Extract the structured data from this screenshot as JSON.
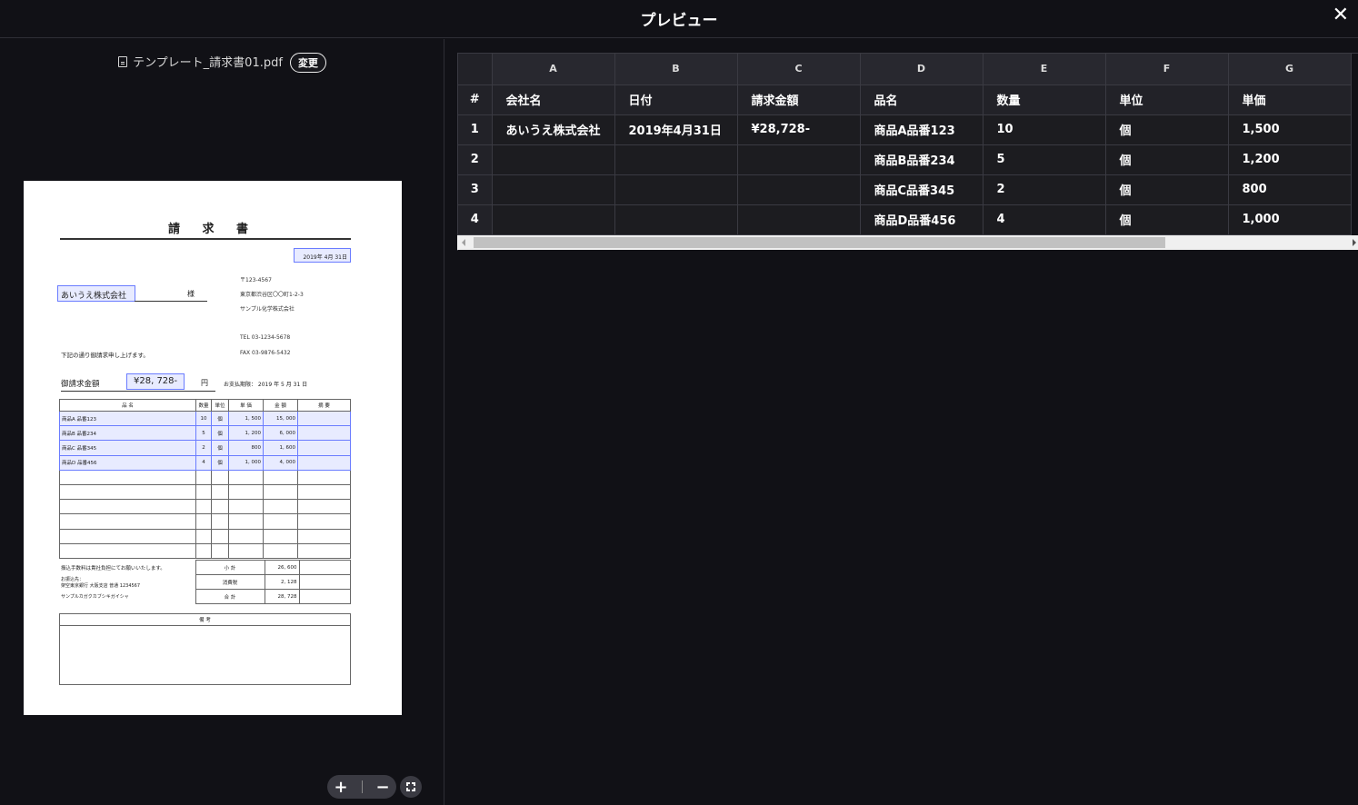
{
  "header": {
    "title": "プレビュー",
    "close": "✕"
  },
  "file": {
    "name": "テンプレート_請求書01.pdf",
    "change_label": "変更"
  },
  "invoice": {
    "title": "請 求 書",
    "date": "2019年 4月 31日",
    "company": "あいうえ株式会社",
    "honorific": "様",
    "address": [
      "〒123-4567",
      "東京都渋谷区〇〇町1-2-3",
      "サンプル化学株式会社",
      "TEL 03-1234-5678",
      "FAX 03-9876-5432"
    ],
    "note": "下記の通り御請求申し上げます。",
    "amount_label": "御請求金額",
    "amount": "¥28, 728-",
    "yen": "円",
    "due": "お支払期限： 2019 年 5 月 31 日",
    "table_headers": [
      "品 名",
      "数量",
      "単位",
      "単 価",
      "金 額",
      "摘 要"
    ],
    "rows": [
      [
        "商品A 品番123",
        "10",
        "個",
        "1, 500",
        "15, 000",
        ""
      ],
      [
        "商品B 品番234",
        "5",
        "個",
        "1, 200",
        "6, 000",
        ""
      ],
      [
        "商品C 品番345",
        "2",
        "個",
        "800",
        "1, 600",
        ""
      ],
      [
        "商品D 品番456",
        "4",
        "個",
        "1, 000",
        "4, 000",
        ""
      ]
    ],
    "bank_note": "振込手数料は貴社負担にてお願いいたします。",
    "bank_info": "お振込先：",
    "bank_detail1": "架空東京銀行 大阪支店 普通 1234567",
    "bank_detail2": "サンプルカガクカブシキガイシャ",
    "subtotal_label": "小 計",
    "subtotal": "26, 600",
    "tax_label": "消費税",
    "tax": "2, 128",
    "total_label": "合 計",
    "total": "28, 728",
    "remarks_label": "備 考"
  },
  "zoom": {
    "in": "+",
    "out": "−"
  },
  "grid": {
    "columns": [
      "A",
      "B",
      "C",
      "D",
      "E",
      "F",
      "G"
    ],
    "row_header": "#",
    "fields": [
      "会社名",
      "日付",
      "請求金額",
      "品名",
      "数量",
      "単位",
      "単価"
    ],
    "rows": [
      [
        "1",
        "あいうえ株式会社",
        "2019年4月31日",
        "¥28,728-",
        "商品A品番123",
        "10",
        "個",
        "1,500"
      ],
      [
        "2",
        "",
        "",
        "",
        "商品B品番234",
        "5",
        "個",
        "1,200"
      ],
      [
        "3",
        "",
        "",
        "",
        "商品C品番345",
        "2",
        "個",
        "800"
      ],
      [
        "4",
        "",
        "",
        "",
        "商品D品番456",
        "4",
        "個",
        "1,000"
      ]
    ]
  }
}
